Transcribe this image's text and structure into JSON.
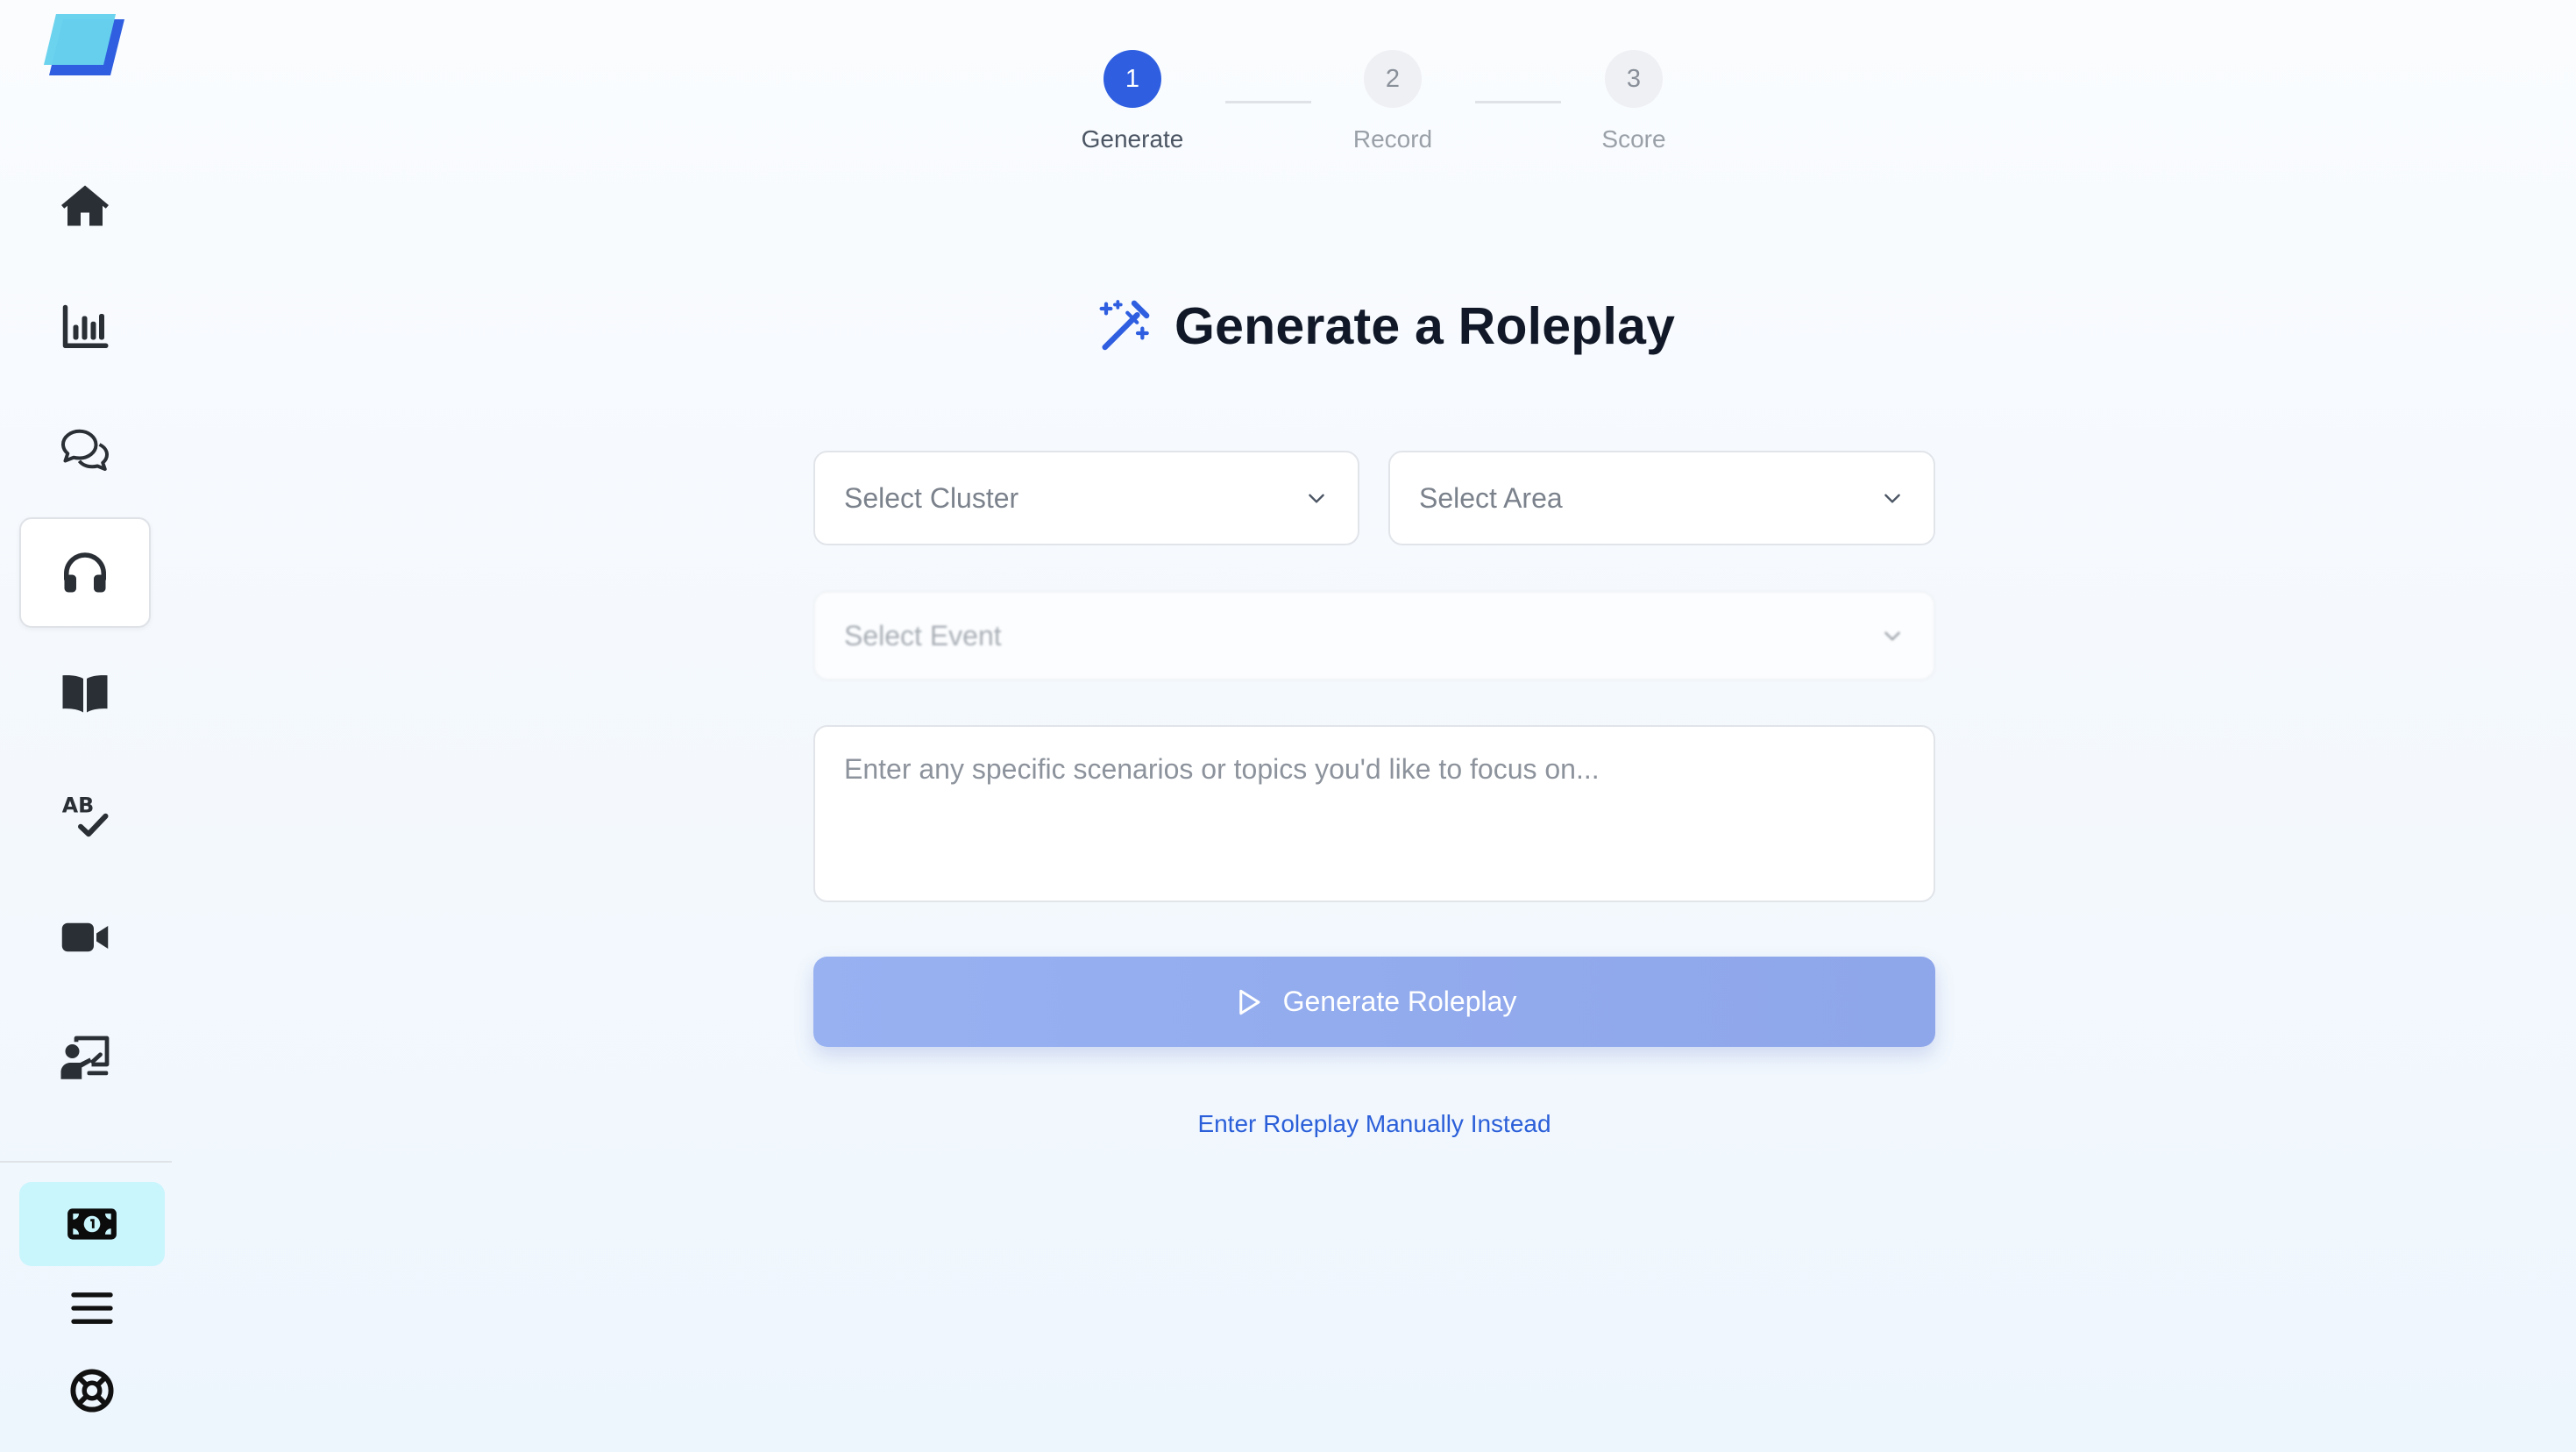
{
  "theme": {
    "accent": "#2f5fe0",
    "button_bg": "#93acef",
    "link": "#2b5fd9",
    "cash_highlight": "#c9f5fd",
    "icon": "#2a2f36"
  },
  "sidebar": {
    "logo_icon": "parallelogram-logo",
    "items": [
      {
        "icon": "home-icon",
        "active": false
      },
      {
        "icon": "bar-chart-icon",
        "active": false
      },
      {
        "icon": "chat-bubbles-icon",
        "active": false
      },
      {
        "icon": "headphones-icon",
        "active": true
      },
      {
        "icon": "open-book-icon",
        "active": false
      },
      {
        "icon": "spell-check-icon",
        "active": false
      },
      {
        "icon": "video-camera-icon",
        "active": false
      },
      {
        "icon": "presenter-icon",
        "active": false
      }
    ],
    "bottom": [
      {
        "icon": "money-bill-icon",
        "highlighted": true
      },
      {
        "icon": "hamburger-menu-icon",
        "highlighted": false
      },
      {
        "icon": "life-ring-icon",
        "highlighted": false
      }
    ]
  },
  "stepper": {
    "steps": [
      {
        "number": "1",
        "label": "Generate",
        "active": true
      },
      {
        "number": "2",
        "label": "Record",
        "active": false
      },
      {
        "number": "3",
        "label": "Score",
        "active": false
      }
    ]
  },
  "main": {
    "title_icon": "magic-wand-icon",
    "title": "Generate a Roleplay",
    "cluster_select": {
      "placeholder": "Select Cluster"
    },
    "area_select": {
      "placeholder": "Select Area"
    },
    "event_select": {
      "placeholder": "Select Event",
      "disabled": true
    },
    "scenario_textarea": {
      "placeholder": "Enter any specific scenarios or topics you'd like to focus on..."
    },
    "generate_button": {
      "label": "Generate Roleplay",
      "icon": "play-icon"
    },
    "manual_link": "Enter Roleplay Manually Instead"
  }
}
